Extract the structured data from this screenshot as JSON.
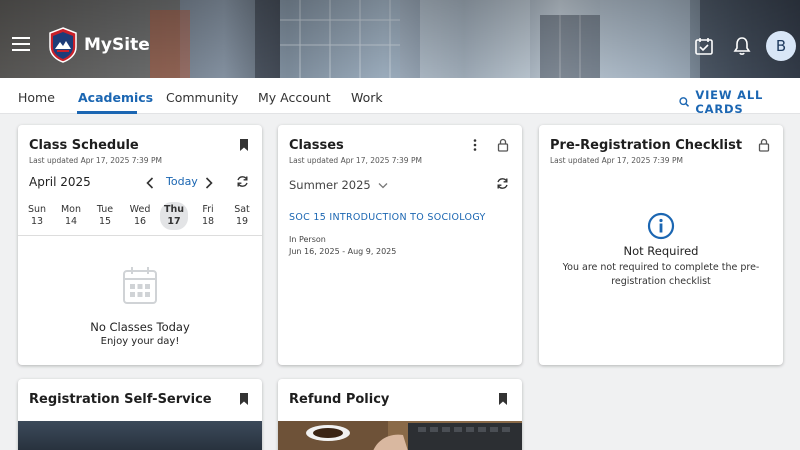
{
  "header": {
    "site_name": "MySite",
    "avatar_initial": "B",
    "icons": [
      "menu-icon",
      "site-logo",
      "calendar-check-icon",
      "bell-icon"
    ]
  },
  "tabs": [
    {
      "label": "Home",
      "active": false
    },
    {
      "label": "Academics",
      "active": true
    },
    {
      "label": "Community",
      "active": false
    },
    {
      "label": "My Account",
      "active": false
    },
    {
      "label": "Work",
      "active": false
    }
  ],
  "view_all_label": "VIEW ALL CARDS",
  "class_schedule": {
    "title": "Class Schedule",
    "updated": "Last updated Apr 17, 2025 7:39 PM",
    "month": "April 2025",
    "today_label": "Today",
    "days": [
      {
        "name": "Sun",
        "num": "13"
      },
      {
        "name": "Mon",
        "num": "14"
      },
      {
        "name": "Tue",
        "num": "15"
      },
      {
        "name": "Wed",
        "num": "16"
      },
      {
        "name": "Thu",
        "num": "17",
        "selected": true
      },
      {
        "name": "Fri",
        "num": "18"
      },
      {
        "name": "Sat",
        "num": "19"
      }
    ],
    "empty_title": "No Classes Today",
    "empty_sub": "Enjoy your day!"
  },
  "classes": {
    "title": "Classes",
    "updated": "Last updated Apr 17, 2025 7:39 PM",
    "term": "Summer 2025",
    "course": "SOC 15 INTRODUCTION TO SOCIOLOGY",
    "mode": "In Person",
    "dates": "Jun 16, 2025 - Aug 9, 2025"
  },
  "prereg": {
    "title": "Pre-Registration Checklist",
    "updated": "Last updated Apr 17, 2025 7:39 PM",
    "status": "Not Required",
    "message": "You are not required to complete the pre-registration checklist"
  },
  "registration": {
    "title": "Registration Self-Service"
  },
  "refund": {
    "title": "Refund Policy"
  },
  "colors": {
    "accent": "#1b66b2",
    "background": "#f0f1f2"
  }
}
